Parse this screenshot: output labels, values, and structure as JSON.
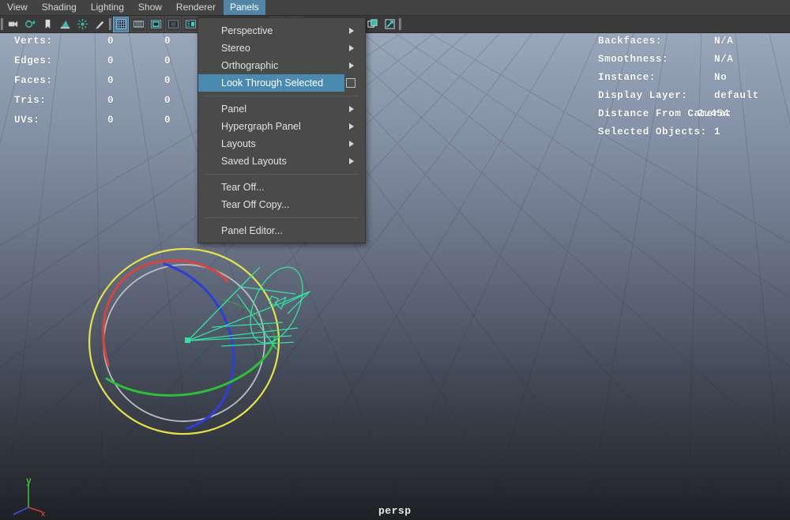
{
  "app": {
    "viewport_label": "persp",
    "accent_blue": "#5285a6",
    "menu_highlight": "#4a8ab0",
    "hud_text_color": "#ffffff"
  },
  "menubar": {
    "items": [
      {
        "label": "View",
        "name": "menu-view",
        "active": false
      },
      {
        "label": "Shading",
        "name": "menu-shading",
        "active": false
      },
      {
        "label": "Lighting",
        "name": "menu-lighting",
        "active": false
      },
      {
        "label": "Show",
        "name": "menu-show",
        "active": false
      },
      {
        "label": "Renderer",
        "name": "menu-renderer",
        "active": false
      },
      {
        "label": "Panels",
        "name": "menu-panels",
        "active": true
      }
    ]
  },
  "toolbar": {
    "icons": [
      "separator-icon",
      "camera-icon",
      "camera-attributes-icon",
      "bookmark-icon",
      "image-plane-icon",
      "two-sided-lighting-icon",
      "paint-effects-icon",
      "separator-icon",
      "grid-icon",
      "film-gate-icon",
      "resolution-gate-icon",
      "gate-mask-icon",
      "film-origin-icon",
      "spacer",
      "playback-arrow-icon",
      "xray-icon",
      "xray-joints-icon",
      "smooth-shade-icon",
      "wireframe-on-shaded-icon",
      "separator-icon",
      "isolate-select-icon",
      "pointer-select-icon",
      "separator-icon",
      "panel-single-icon",
      "panel-copy-icon",
      "panel-snapshot-icon",
      "separator-icon"
    ]
  },
  "hud_left": {
    "rows": [
      {
        "label": "Verts:",
        "col1": "0",
        "col2": "0"
      },
      {
        "label": "Edges:",
        "col1": "0",
        "col2": "0"
      },
      {
        "label": "Faces:",
        "col1": "0",
        "col2": "0"
      },
      {
        "label": "Tris:",
        "col1": "0",
        "col2": "0"
      },
      {
        "label": "UVs:",
        "col1": "0",
        "col2": "0"
      }
    ]
  },
  "hud_right": {
    "rows": [
      {
        "label": "Backfaces:",
        "value": "N/A"
      },
      {
        "label": "Smoothness:",
        "value": "N/A"
      },
      {
        "label": "Instance:",
        "value": "No"
      },
      {
        "label": "Display Layer:",
        "value": "default"
      },
      {
        "label": "Distance From Camera:",
        "value": "2.454"
      },
      {
        "label": "Selected Objects:",
        "value": "1"
      }
    ]
  },
  "panels_menu": {
    "items": [
      {
        "label": "Perspective",
        "name": "menu-item-perspective",
        "submenu": true,
        "highlighted": false,
        "optionbox": false,
        "divider_after": false
      },
      {
        "label": "Stereo",
        "name": "menu-item-stereo",
        "submenu": true,
        "highlighted": false,
        "optionbox": false,
        "divider_after": false
      },
      {
        "label": "Orthographic",
        "name": "menu-item-orthographic",
        "submenu": true,
        "highlighted": false,
        "optionbox": false,
        "divider_after": false
      },
      {
        "label": "Look Through Selected",
        "name": "menu-item-look-through-selected",
        "submenu": false,
        "highlighted": true,
        "optionbox": true,
        "divider_after": true
      },
      {
        "label": "Panel",
        "name": "menu-item-panel",
        "submenu": true,
        "highlighted": false,
        "optionbox": false,
        "divider_after": false
      },
      {
        "label": "Hypergraph Panel",
        "name": "menu-item-hypergraph-panel",
        "submenu": true,
        "highlighted": false,
        "optionbox": false,
        "divider_after": false
      },
      {
        "label": "Layouts",
        "name": "menu-item-layouts",
        "submenu": true,
        "highlighted": false,
        "optionbox": false,
        "divider_after": false
      },
      {
        "label": "Saved Layouts",
        "name": "menu-item-saved-layouts",
        "submenu": true,
        "highlighted": false,
        "optionbox": false,
        "divider_after": true
      },
      {
        "label": "Tear Off...",
        "name": "menu-item-tear-off",
        "submenu": false,
        "highlighted": false,
        "optionbox": false,
        "divider_after": false
      },
      {
        "label": "Tear Off Copy...",
        "name": "menu-item-tear-off-copy",
        "submenu": false,
        "highlighted": false,
        "optionbox": false,
        "divider_after": true
      },
      {
        "label": "Panel Editor...",
        "name": "menu-item-panel-editor",
        "submenu": false,
        "highlighted": false,
        "optionbox": false,
        "divider_after": false
      }
    ]
  },
  "axis_gizmo": {
    "x_label": "x",
    "y_label": "y",
    "z_label": "",
    "x_color": "#d23b3b",
    "y_color": "#34c23a",
    "z_color": "#3a52d8"
  },
  "scene": {
    "manipulator": "rotate-manipulator",
    "rings": [
      {
        "axis": "X",
        "color": "#d24545"
      },
      {
        "axis": "Y",
        "color": "#2fbe3a"
      },
      {
        "axis": "Z",
        "color": "#2f3fd6"
      },
      {
        "axis": "view",
        "color": "#e8e24a"
      },
      {
        "axis": "outer",
        "color": "#b9bcc4"
      }
    ],
    "selected_object": "spotlight-cone",
    "selected_color": "#36e0a2"
  }
}
